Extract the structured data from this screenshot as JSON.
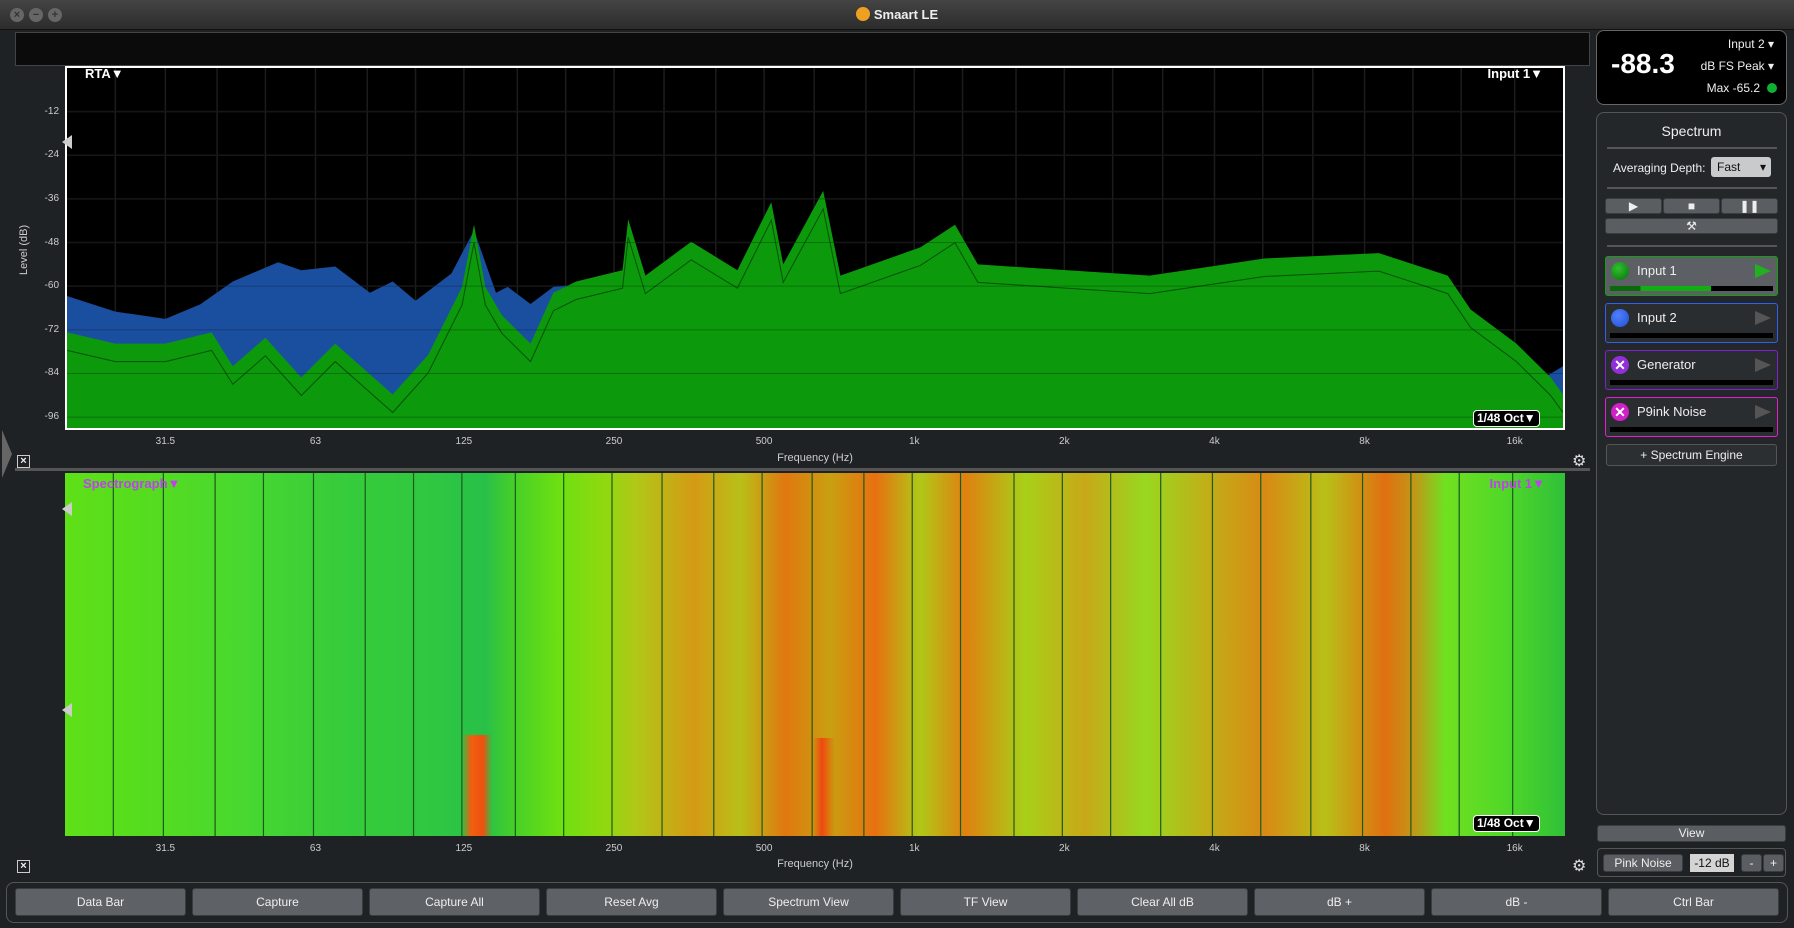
{
  "window": {
    "title": "Smaart LE"
  },
  "rta": {
    "label": "RTA▼",
    "input_label": "Input 1▼",
    "resolution": "1/48 Oct▼",
    "ylabel": "Level (dB)",
    "xlabel": "Frequency (Hz)"
  },
  "spectrograph": {
    "label": "Spectrograph▼",
    "input_label": "Input 1▼",
    "resolution": "1/48 Oct▼",
    "xlabel": "Frequency (Hz)"
  },
  "meter": {
    "value": "-88.3",
    "input": "Input 2",
    "mode": "dB FS Peak",
    "max": "Max -65.2",
    "status_color": "#10b030"
  },
  "panel": {
    "title": "Spectrum",
    "avg_label": "Averaging Depth:",
    "avg_value": "Fast",
    "channels": [
      {
        "name": "Input 1",
        "color": "#10a010",
        "active": true,
        "level": 0.62
      },
      {
        "name": "Input 2",
        "color": "#3060f0",
        "active": false,
        "level": 0
      },
      {
        "name": "Generator",
        "color": "#8020d0",
        "icon": "x-icon",
        "active": false,
        "level": 0
      },
      {
        "name": "P9ink Noise",
        "color": "#e020d0",
        "icon": "x-icon",
        "active": false,
        "level": 0
      }
    ],
    "add_engine": "+ Spectrum Engine",
    "view": "View",
    "pink_noise": "Pink Noise",
    "gen_level": "-12 dB",
    "minus": "-",
    "plus": "+"
  },
  "bottom_buttons": [
    "Data Bar",
    "Capture",
    "Capture All",
    "Reset Avg",
    "Spectrum View",
    "TF View",
    "Clear All dB",
    "dB +",
    "dB -",
    "Ctrl Bar"
  ],
  "chart_data": {
    "type": "area",
    "xscale": "log",
    "xlim": [
      20,
      20000
    ],
    "ylim": [
      -99,
      0
    ],
    "grid": true,
    "xlabel": "Frequency (Hz)",
    "ylabel": "Level (dB)",
    "xticks": [
      "31.5",
      "63",
      "125",
      "250",
      "500",
      "1k",
      "2k",
      "4k",
      "8k",
      "16k"
    ],
    "xtick_values": [
      31.5,
      63,
      125,
      250,
      500,
      1000,
      2000,
      4000,
      8000,
      16000
    ],
    "yticks": [
      -12,
      -24,
      -36,
      -48,
      -60,
      -72,
      -84,
      -96
    ],
    "series": [
      {
        "name": "Input 2",
        "color": "#1a4fa0",
        "points": [
          [
            20,
            -62.7
          ],
          [
            25,
            -67
          ],
          [
            31.5,
            -69
          ],
          [
            37,
            -65
          ],
          [
            43,
            -58.7
          ],
          [
            53,
            -53.4
          ],
          [
            59,
            -55.6
          ],
          [
            69,
            -54.6
          ],
          [
            81,
            -61.8
          ],
          [
            90,
            -58.7
          ],
          [
            100,
            -64
          ],
          [
            118,
            -56.5
          ],
          [
            131,
            -44.7
          ],
          [
            145,
            -61.8
          ],
          [
            153,
            -60.2
          ],
          [
            170,
            -64.9
          ],
          [
            189,
            -60.2
          ],
          [
            210,
            -59.6
          ],
          [
            250,
            -66
          ],
          [
            500,
            -75
          ],
          [
            1000,
            -80
          ],
          [
            4000,
            -85
          ],
          [
            16000,
            -90
          ],
          [
            20000,
            -82
          ]
        ]
      },
      {
        "name": "Input 1",
        "color": "#0c9a0c",
        "points": [
          [
            20,
            -72.7
          ],
          [
            25,
            -75.8
          ],
          [
            31.5,
            -75.8
          ],
          [
            39,
            -72.7
          ],
          [
            43,
            -82
          ],
          [
            50,
            -74.2
          ],
          [
            59,
            -85.1
          ],
          [
            69,
            -75.8
          ],
          [
            90,
            -89.8
          ],
          [
            106,
            -78.9
          ],
          [
            124,
            -60.2
          ],
          [
            131,
            -43.1
          ],
          [
            138,
            -60.2
          ],
          [
            149,
            -68
          ],
          [
            170,
            -75.8
          ],
          [
            189,
            -61.8
          ],
          [
            210,
            -58.7
          ],
          [
            260,
            -55.6
          ],
          [
            267,
            -41.6
          ],
          [
            289,
            -57.1
          ],
          [
            357,
            -47.8
          ],
          [
            442,
            -55.6
          ],
          [
            517,
            -36.9
          ],
          [
            546,
            -54
          ],
          [
            657,
            -33.8
          ],
          [
            711,
            -57.1
          ],
          [
            1030,
            -49.3
          ],
          [
            1207,
            -43.1
          ],
          [
            1342,
            -54
          ],
          [
            2967,
            -57.1
          ],
          [
            5036,
            -52.4
          ],
          [
            8549,
            -50.9
          ],
          [
            11743,
            -57.1
          ],
          [
            13054,
            -66.4
          ],
          [
            16128,
            -75.8
          ],
          [
            18900,
            -85.1
          ],
          [
            20000,
            -89.8
          ]
        ]
      }
    ]
  }
}
